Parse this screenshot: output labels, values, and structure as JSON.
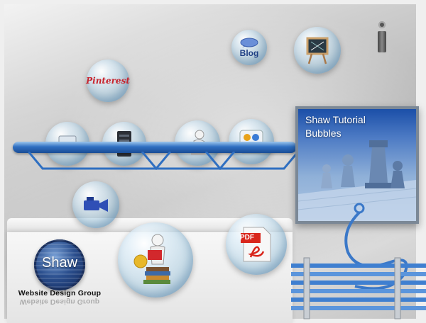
{
  "header": {
    "info_label": "i"
  },
  "bubbles": {
    "pinterest_label": "Pinterest",
    "blog_label": "Blog",
    "pdf_label": "PDF"
  },
  "tutorial": {
    "title_line1": "Shaw Tutorial",
    "title_line2": "Bubbles"
  },
  "brand": {
    "logo_word": "Shaw",
    "group_name": "Website Design Group"
  },
  "colors": {
    "accent_blue": "#2f6fc1",
    "pinterest_red": "#c8232c",
    "pdf_red": "#d9261c",
    "panel_blue": "#1b4fa8"
  },
  "icons": [
    "pinterest-icon",
    "blog-icon",
    "presentation-board-icon",
    "info-icon",
    "laptop-icon",
    "server-icon",
    "person-reading-icon",
    "apps-grid-icon",
    "camcorder-icon",
    "student-books-icon",
    "pdf-icon",
    "shaw-logo"
  ]
}
